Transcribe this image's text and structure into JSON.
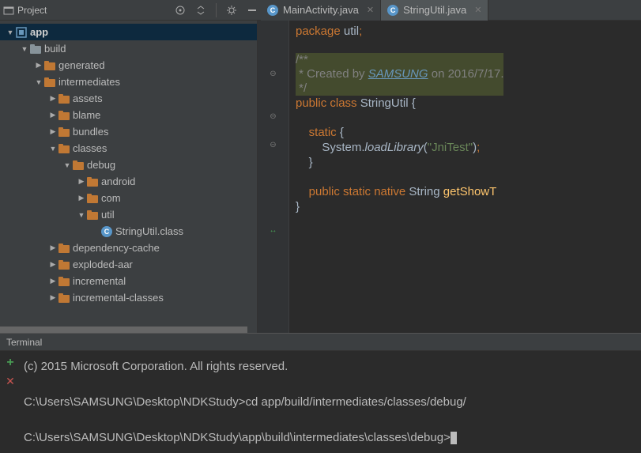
{
  "toolbar": {
    "title": "Project"
  },
  "tabs": [
    {
      "label": "MainActivity.java",
      "active": false
    },
    {
      "label": "StringUtil.java",
      "active": true
    }
  ],
  "tree": [
    {
      "indent": 0,
      "arrow": "open",
      "icon": "module",
      "label": "app",
      "bold": true,
      "selected": true,
      "name": "tree-app"
    },
    {
      "indent": 1,
      "arrow": "open",
      "icon": "folder-gray",
      "label": "build",
      "name": "tree-build"
    },
    {
      "indent": 2,
      "arrow": "closed",
      "icon": "folder-orange",
      "label": "generated",
      "name": "tree-generated"
    },
    {
      "indent": 2,
      "arrow": "open",
      "icon": "folder-orange",
      "label": "intermediates",
      "name": "tree-intermediates"
    },
    {
      "indent": 3,
      "arrow": "closed",
      "icon": "folder-orange",
      "label": "assets",
      "name": "tree-assets"
    },
    {
      "indent": 3,
      "arrow": "closed",
      "icon": "folder-orange",
      "label": "blame",
      "name": "tree-blame"
    },
    {
      "indent": 3,
      "arrow": "closed",
      "icon": "folder-orange",
      "label": "bundles",
      "name": "tree-bundles"
    },
    {
      "indent": 3,
      "arrow": "open",
      "icon": "folder-orange",
      "label": "classes",
      "name": "tree-classes"
    },
    {
      "indent": 4,
      "arrow": "open",
      "icon": "folder-orange",
      "label": "debug",
      "name": "tree-debug"
    },
    {
      "indent": 5,
      "arrow": "closed",
      "icon": "folder-orange",
      "label": "android",
      "name": "tree-android"
    },
    {
      "indent": 5,
      "arrow": "closed",
      "icon": "folder-orange",
      "label": "com",
      "name": "tree-com"
    },
    {
      "indent": 5,
      "arrow": "open",
      "icon": "folder-orange",
      "label": "util",
      "name": "tree-util"
    },
    {
      "indent": 6,
      "arrow": "none",
      "icon": "class",
      "label": "StringUtil.class",
      "name": "tree-stringutil-class"
    },
    {
      "indent": 3,
      "arrow": "closed",
      "icon": "folder-orange",
      "label": "dependency-cache",
      "name": "tree-dependency-cache"
    },
    {
      "indent": 3,
      "arrow": "closed",
      "icon": "folder-orange",
      "label": "exploded-aar",
      "name": "tree-exploded-aar"
    },
    {
      "indent": 3,
      "arrow": "closed",
      "icon": "folder-orange",
      "label": "incremental",
      "name": "tree-incremental"
    },
    {
      "indent": 3,
      "arrow": "closed",
      "icon": "folder-orange",
      "label": "incremental-classes",
      "name": "tree-incremental-classes"
    }
  ],
  "code": {
    "l1a": "package",
    "l1b": " util",
    "l1c": ";",
    "l3": "/**",
    "l4a": " * Created by ",
    "l4b": "SAMSUNG",
    "l4c": " on 2016/7/17.",
    "l5": " */",
    "l6a": "public class ",
    "l6b": "StringUtil {",
    "l8a": "    static ",
    "l8b": "{",
    "l9a": "        System.",
    "l9b": "loadLibrary",
    "l9c": "(",
    "l9d": "\"JniTest\"",
    "l9e": ")",
    "l9f": ";",
    "l10": "    }",
    "l12a": "    public static native ",
    "l12b": "String ",
    "l12c": "getShowT",
    "l13": "}"
  },
  "terminal": {
    "title": "Terminal",
    "line1": "(c) 2015 Microsoft Corporation. All rights reserved.",
    "prompt1": "C:\\Users\\SAMSUNG\\Desktop\\NDKStudy>",
    "cmd1": "cd app/build/intermediates/classes/debug/",
    "prompt2": "C:\\Users\\SAMSUNG\\Desktop\\NDKStudy\\app\\build\\intermediates\\classes\\debug>"
  }
}
